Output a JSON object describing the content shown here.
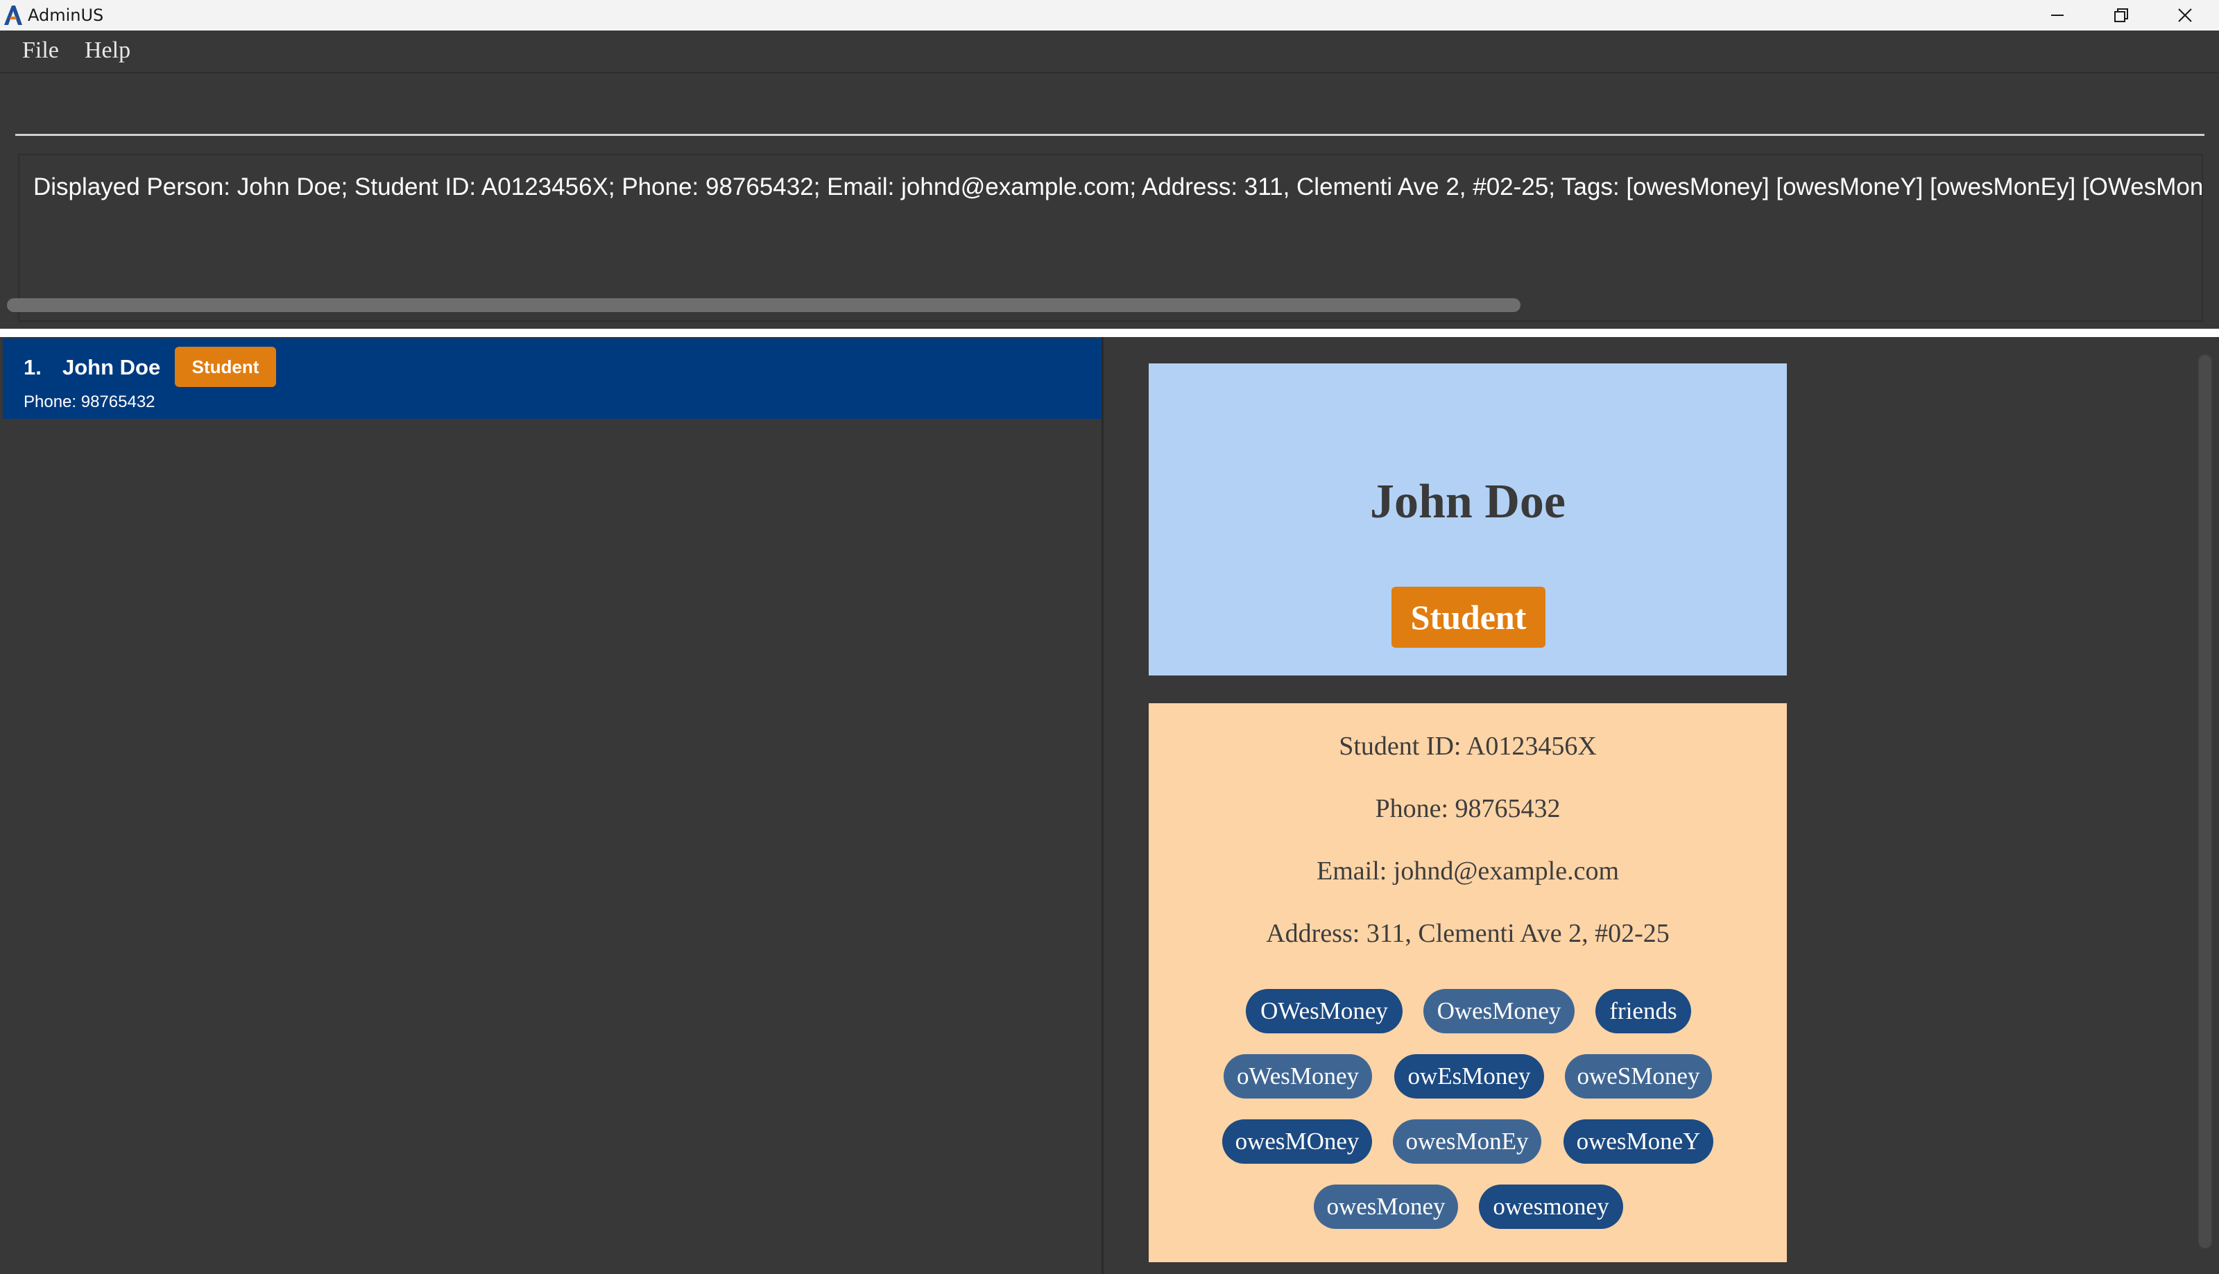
{
  "window": {
    "title": "AdminUS",
    "logo_icon": "admin-logo-icon",
    "controls": [
      "minimize-icon",
      "maximize-icon",
      "close-icon"
    ]
  },
  "menu": {
    "file": "File",
    "help": "Help"
  },
  "command": {
    "value": "",
    "placeholder": ""
  },
  "result": {
    "text": "Displayed Person: John Doe; Student ID: A0123456X; Phone: 98765432; Email: johnd@example.com; Address: 311, Clementi Ave 2, #02-25; Tags: [owesMoney] [owesMoneY] [owesMonEy] [OWesMoney] [ov"
  },
  "list": {
    "items": [
      {
        "index": "1.",
        "name": "John Doe",
        "role": "Student",
        "phone": "Phone: 98765432"
      }
    ]
  },
  "detail": {
    "name": "John Doe",
    "role": "Student",
    "student_id": "Student ID: A0123456X",
    "phone": "Phone: 98765432",
    "email": "Email: johnd@example.com",
    "address": "Address: 311, Clementi Ave 2, #02-25",
    "tags": [
      "OWesMoney",
      "OwesMoney",
      "friends",
      "oWesMoney",
      "owEsMoney",
      "oweSMoney",
      "owesMOney",
      "owesMonEy",
      "owesMoneY",
      "owesMoney",
      "owesmoney"
    ]
  },
  "colors": {
    "selected_card": "#003a7e",
    "role_badge": "#e07d10",
    "header_card": "#b3d1f5",
    "info_card": "#fdd4a6",
    "tag_dark": "#1c4a82",
    "tag_light": "#3f6693",
    "background": "#383838"
  }
}
